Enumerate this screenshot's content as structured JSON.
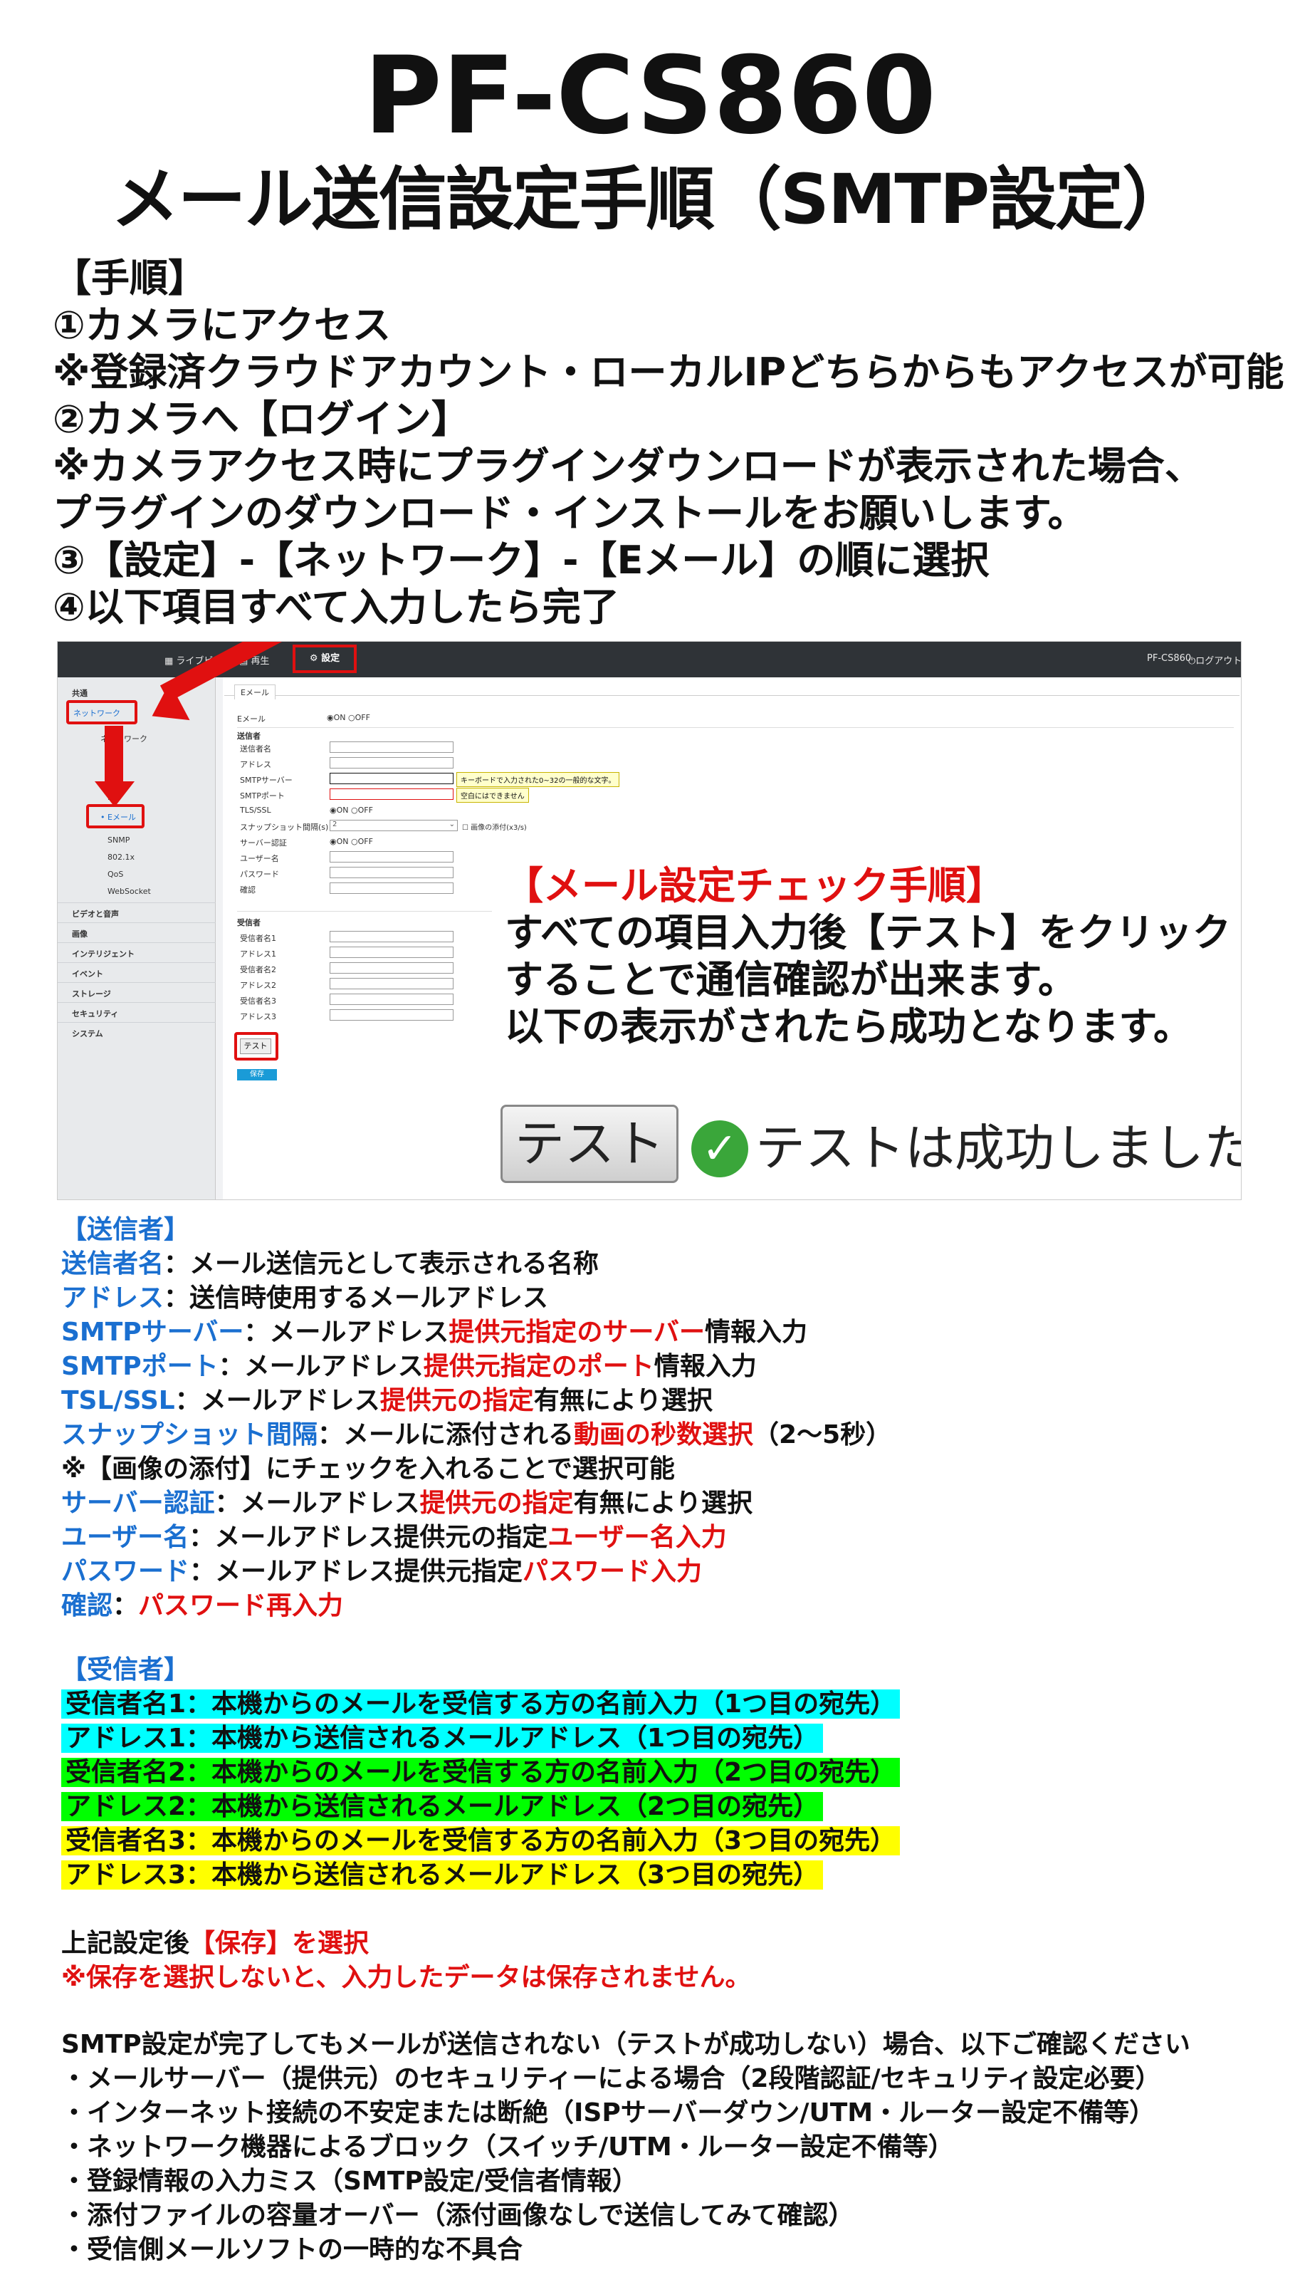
{
  "title": "PF-CS860",
  "subtitle": "メール送信設定手順（SMTP設定）",
  "steps": [
    "【手順】",
    "①カメラにアクセス",
    "※登録済クラウドアカウント・ローカルIPどちらからもアクセスが可能",
    "②カメラへ【ログイン】",
    "※カメラアクセス時にプラグインダウンロードが表示された場合、",
    "プラグインのダウンロード・インストールをお願いします。",
    "③【設定】-【ネットワーク】-【Eメール】の順に選択",
    "④以下項目すべて入力したら完了"
  ],
  "screenshot": {
    "topbar": {
      "live": "ライブビュー",
      "playback": "再生",
      "settings": "設定",
      "model": "PF-CS860",
      "logout": "ログアウト"
    },
    "sidebar": {
      "common": "共通",
      "network": "ネットワーク",
      "network_items": [
        "ネットワーク",
        "ト",
        "P2P",
        "Eメール",
        "SNMP",
        "802.1x",
        "QoS",
        "WebSocket"
      ],
      "groups": [
        "ビデオと音声",
        "画像",
        "インテリジェント",
        "イベント",
        "ストレージ",
        "セキュリティ",
        "システム"
      ]
    },
    "tab": "Eメール",
    "form": {
      "email": "Eメール",
      "on": "ON",
      "off": "OFF",
      "sender_heading": "送信者",
      "sender_fields": [
        "送信者名",
        "アドレス",
        "SMTPサーバー",
        "SMTPポート",
        "TLS/SSL",
        "スナップショット間隔(s)",
        "サーバー認証",
        "ユーザー名",
        "パスワード",
        "確認"
      ],
      "interval_value": "2",
      "attach_label": "画像の添付(x3/s)",
      "tip_server": "キーボードで入力された0~32の一般的な文字。",
      "tip_port": "空白にはできません",
      "receiver_heading": "受信者",
      "receiver_fields": [
        "受信者名1",
        "アドレス1",
        "受信者名2",
        "アドレス2",
        "受信者名3",
        "アドレス3"
      ],
      "test_button": "テスト",
      "save_button": "保存"
    },
    "check_panel": [
      "【メール設定チェック手順】",
      "すべての項目入力後【テスト】をクリック",
      "することで通信確認が出来ます。",
      "以下の表示がされたら成功となります。"
    ],
    "test_big": "テスト",
    "success_msg": "テストは成功しました"
  },
  "sender_section": {
    "heading": "【送信者】",
    "rows": [
      {
        "term": "送信者名",
        "text": "：メール送信元として表示される名称"
      },
      {
        "term": "アドレス",
        "text": "：送信時使用するメールアドレス"
      },
      {
        "term": "SMTPサーバー",
        "a": "：メールアドレス",
        "red": "提供元指定のサーバー",
        "b": "情報入力"
      },
      {
        "term": "SMTPポート",
        "a": "：メールアドレス",
        "red": "提供元指定のポート",
        "b": "情報入力"
      },
      {
        "term": "TSL/SSL",
        "a": "：メールアドレス",
        "red": "提供元の指定",
        "b": "有無により選択"
      },
      {
        "term": "スナップショット間隔",
        "a": "：メールに添付される",
        "red": "動画の秒数選択",
        "b": "（2～5秒）"
      },
      {
        "note": "※【画像の添付】にチェックを入れることで選択可能"
      },
      {
        "term": "サーバー認証",
        "a": "：メールアドレス",
        "red": "提供元の指定",
        "b": "有無により選択"
      },
      {
        "term": "ユーザー名",
        "a": "：メールアドレス提供元の指定",
        "red": "ユーザー名入力",
        "b": ""
      },
      {
        "term": "パスワード",
        "a": "：メールアドレス提供元指定",
        "red": "パスワード入力",
        "b": ""
      },
      {
        "term": "確認",
        "a": "：",
        "red": "パスワード再入力",
        "b": ""
      }
    ]
  },
  "receiver_section": {
    "heading": "【受信者】",
    "rows": [
      {
        "text": "受信者名1：本機からのメールを受信する方の名前入力（1つ目の宛先）",
        "color": "#00ffff"
      },
      {
        "text": "アドレス1：本機から送信されるメールアドレス（1つ目の宛先）",
        "color": "#00ffff"
      },
      {
        "text": "受信者名2：本機からのメールを受信する方の名前入力（2つ目の宛先）",
        "color": "#00ff00"
      },
      {
        "text": "アドレス2：本機から送信されるメールアドレス（2つ目の宛先）",
        "color": "#00ff00"
      },
      {
        "text": "受信者名3：本機からのメールを受信する方の名前入力（3つ目の宛先）",
        "color": "#ffff00"
      },
      {
        "text": "アドレス3：本機から送信されるメールアドレス（3つ目の宛先）",
        "color": "#ffff00"
      }
    ]
  },
  "save_note": {
    "prefix": "上記設定後",
    "save": "【保存】を選択",
    "warning": "※保存を選択しないと、入力したデータは保存されません。"
  },
  "troubleshoot": [
    "SMTP設定が完了してもメールが送信されない（テストが成功しない）場合、以下ご確認ください",
    "・メールサーバー（提供元）のセキュリティーによる場合（2段階認証/セキュリティ設定必要）",
    "・インターネット接続の不安定または断絶（ISPサーバーダウン/UTM・ルーター設定不備等）",
    "・ネットワーク機器によるブロック（スイッチ/UTM・ルーター設定不備等）",
    "・登録情報の入力ミス（SMTP設定/受信者情報）",
    "・添付ファイルの容量オーバー（添付画像なしで送信してみて確認）",
    "・受信側メールソフトの一時的な不具合"
  ],
  "colors": {
    "red": "#e01010",
    "blue": "#1a6fd0",
    "cyan": "#00ffff",
    "green": "#00ff00",
    "yellow": "#ffff00"
  }
}
